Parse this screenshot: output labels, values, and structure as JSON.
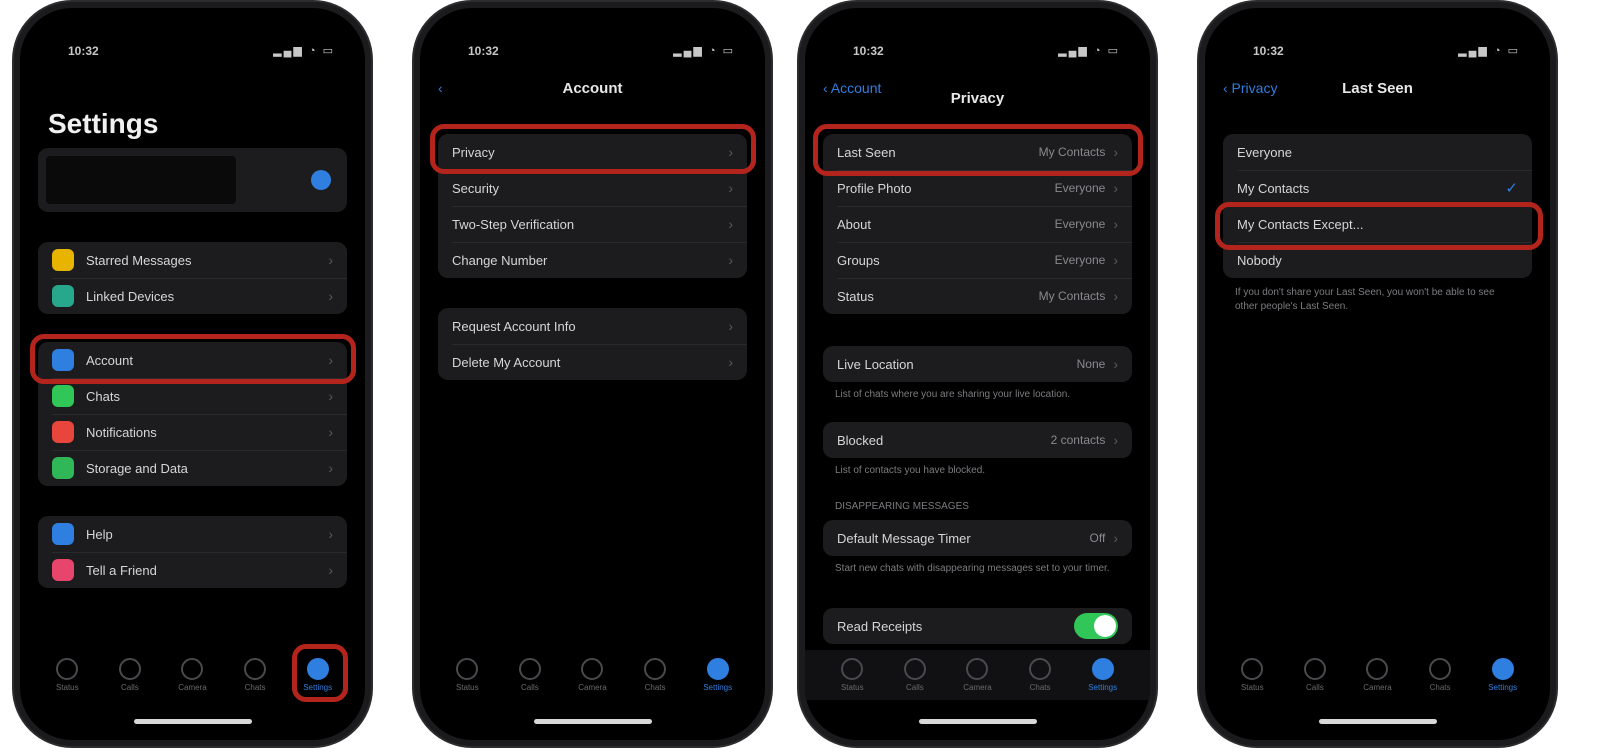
{
  "status_bar": {
    "time": "10:32",
    "icons": "▂▄▆ ◔ ▭"
  },
  "phone1": {
    "title": "Settings",
    "group1": [
      {
        "label": "Starred Messages",
        "color": "#e8b400"
      },
      {
        "label": "Linked Devices",
        "color": "#27a88c"
      }
    ],
    "group2": [
      {
        "label": "Account",
        "color": "#2f7fe0"
      },
      {
        "label": "Chats",
        "color": "#30c758"
      },
      {
        "label": "Notifications",
        "color": "#e8453c"
      },
      {
        "label": "Storage and Data",
        "color": "#30b858"
      }
    ],
    "group3": [
      {
        "label": "Help",
        "color": "#2f7fe0"
      },
      {
        "label": "Tell a Friend",
        "color": "#e8456c"
      }
    ]
  },
  "phone2": {
    "back": "‹",
    "title": "Account",
    "group1": [
      "Privacy",
      "Security",
      "Two-Step Verification",
      "Change Number"
    ],
    "group2": [
      "Request Account Info",
      "Delete My Account"
    ]
  },
  "phone3": {
    "back": "‹ Account",
    "title": "Privacy",
    "group1": [
      {
        "label": "Last Seen",
        "value": "My Contacts"
      },
      {
        "label": "Profile Photo",
        "value": "Everyone"
      },
      {
        "label": "About",
        "value": "Everyone"
      },
      {
        "label": "Groups",
        "value": "Everyone"
      },
      {
        "label": "Status",
        "value": "My Contacts"
      }
    ],
    "live_location": {
      "label": "Live Location",
      "value": "None"
    },
    "live_location_footer": "List of chats where you are sharing your live location.",
    "blocked": {
      "label": "Blocked",
      "value": "2 contacts"
    },
    "blocked_footer": "List of contacts you have blocked.",
    "disappearing_header": "DISAPPEARING MESSAGES",
    "default_timer": {
      "label": "Default Message Timer",
      "value": "Off"
    },
    "default_timer_footer": "Start new chats with disappearing messages set to your timer.",
    "read_receipts": {
      "label": "Read Receipts"
    }
  },
  "phone4": {
    "back": "‹ Privacy",
    "title": "Last Seen",
    "options": [
      "Everyone",
      "My Contacts",
      "My Contacts Except...",
      "Nobody"
    ],
    "footer": "If you don't share your Last Seen, you won't be able to see other people's Last Seen."
  },
  "tabs": [
    "Status",
    "Calls",
    "Camera",
    "Chats",
    "Settings"
  ]
}
